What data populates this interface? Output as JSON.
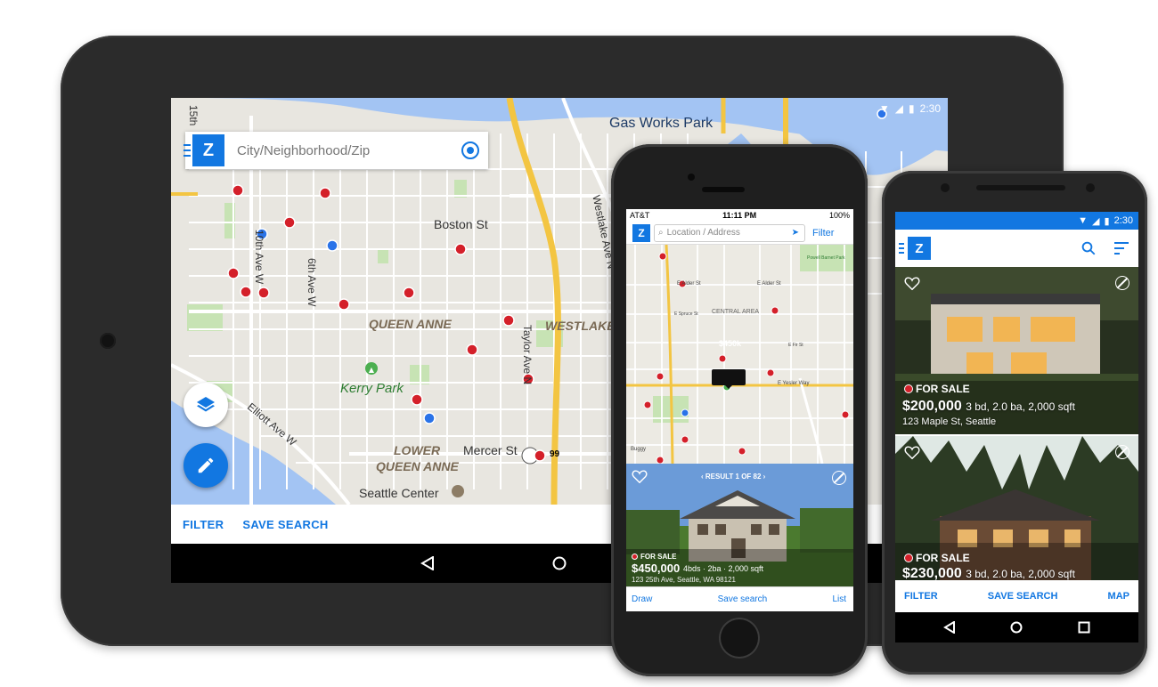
{
  "tablet": {
    "status_time": "2:30",
    "search_placeholder": "City/Neighborhood/Zip",
    "map_labels": {
      "gas_works_park": "Gas Works Park",
      "boston_st": "Boston St",
      "sixth_ave_w": "6th Ave W",
      "tenth_ave_w": "10th Ave W",
      "fifteenth": "15th",
      "queen_anne": "QUEEN ANNE",
      "westlake": "WESTLAKE",
      "kerry_park": "Kerry Park",
      "taylor_ave_n": "Taylor Ave N",
      "westlake_ave_n": "Westlake Ave N",
      "elliott_ave_w": "Elliott Ave W",
      "lower": "LOWER",
      "lower_queen_anne": "QUEEN ANNE",
      "mercer_st": "Mercer St",
      "route_99": "99",
      "seattle_center": "Seattle Center"
    },
    "bottombar": {
      "filter": "FILTER",
      "save_search": "SAVE SEARCH"
    }
  },
  "iphone": {
    "status": {
      "carrier": "AT&T",
      "time": "11:11 PM",
      "battery": "100%"
    },
    "search_placeholder": "Location / Address",
    "filter_label": "Filter",
    "map_labels": {
      "central_area": "CENTRAL AREA",
      "e_alder": "E Alder St",
      "e_alder_2": "E Alder St",
      "e_spruce": "E Spruce St",
      "e_fir": "E Fir St",
      "e_yesler": "E Yesler Way",
      "park": "Powell Barnet Park",
      "buggy": "Buggy",
      "price_tag": "$450k"
    },
    "card": {
      "result": "RESULT 1 OF 82",
      "for_sale": "FOR SALE",
      "price": "$450,000",
      "details": "4bds · 2ba · 2,000 sqft",
      "address": "123 25th Ave, Seattle, WA 98121"
    },
    "bottombar": {
      "draw": "Draw",
      "save_search": "Save search",
      "list": "List"
    }
  },
  "android": {
    "status_time": "2:30",
    "listings": [
      {
        "for_sale": "FOR SALE",
        "price": "$200,000",
        "details": "3 bd, 2.0 ba, 2,000 sqft",
        "address": "123 Maple St, Seattle"
      },
      {
        "for_sale": "FOR SALE",
        "price": "$230,000",
        "details": "3 bd, 2.0 ba, 2,000 sqft",
        "address": ""
      }
    ],
    "bottombar": {
      "filter": "FILTER",
      "save_search": "SAVE SEARCH",
      "map": "MAP"
    }
  },
  "colors": {
    "brand_blue": "#1277e1",
    "pin_red": "#d4202a",
    "pin_blue": "#2a73e8",
    "map_bg": "#e8e6e0",
    "water": "#a3c4f3",
    "park": "#c7e3b4"
  },
  "icons": [
    "zillow-logo-icon",
    "my-location-icon",
    "layers-icon",
    "pencil-icon",
    "back-nav-icon",
    "home-nav-icon",
    "recents-nav-icon",
    "heart-icon",
    "hide-icon",
    "search-icon",
    "sort-icon",
    "location-arrow-icon",
    "wifi-icon",
    "signal-icon",
    "battery-icon"
  ]
}
